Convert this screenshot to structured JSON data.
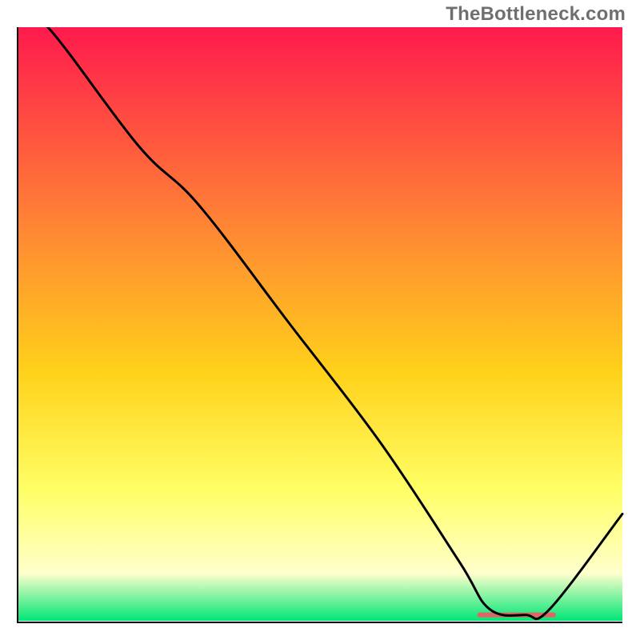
{
  "watermark": "TheBottleneck.com",
  "colors": {
    "gradient_top": "#ff1a4d",
    "gradient_mid_upper": "#ff8a33",
    "gradient_mid": "#ffd11a",
    "gradient_mid_lower": "#ffff66",
    "gradient_pale": "#ffffcc",
    "gradient_bottom": "#00e676",
    "axis": "#000000",
    "curve": "#000000",
    "trough_marker": "#e06666",
    "watermark_text": "#6f6f6f"
  },
  "chart_data": {
    "type": "line",
    "title": "",
    "xlabel": "",
    "ylabel": "",
    "xlim": [
      0,
      100
    ],
    "ylim": [
      0,
      100
    ],
    "series": [
      {
        "name": "bottleneck-curve",
        "x": [
          0,
          5,
          20,
          30,
          45,
          60,
          73,
          78,
          84,
          88,
          100
        ],
        "values": [
          102,
          100,
          80,
          70,
          50,
          30,
          10,
          2,
          1,
          2,
          18
        ]
      }
    ],
    "annotations": [
      {
        "name": "optimal-trough-marker",
        "x_start": 76,
        "x_end": 89,
        "y": 1,
        "color_key": "trough_marker"
      }
    ],
    "background_gradient": {
      "direction": "vertical",
      "stops": [
        {
          "pos": 0.0,
          "color_key": "gradient_top"
        },
        {
          "pos": 0.35,
          "color_key": "gradient_mid_upper"
        },
        {
          "pos": 0.58,
          "color_key": "gradient_mid"
        },
        {
          "pos": 0.78,
          "color_key": "gradient_mid_lower"
        },
        {
          "pos": 0.92,
          "color_key": "gradient_pale"
        },
        {
          "pos": 1.0,
          "color_key": "gradient_bottom"
        }
      ]
    }
  }
}
